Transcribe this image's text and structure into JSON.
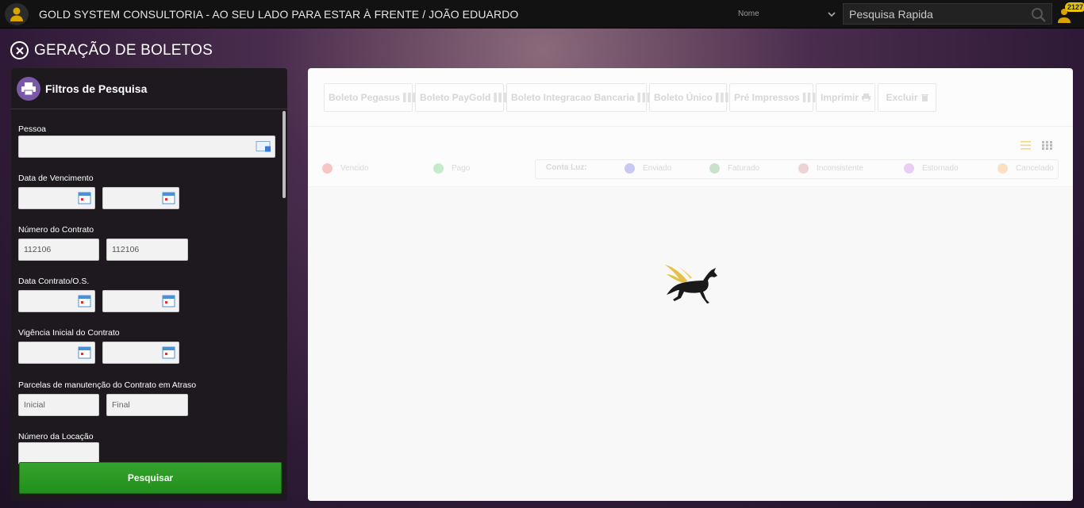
{
  "header": {
    "app_title": "GOLD SYSTEM CONSULTORIA - AO SEU LADO PARA ESTAR À FRENTE / JOÃO EDUARDO",
    "name_select": "Nome",
    "search_placeholder": "Pesquisa Rapida",
    "notification_count": "2127"
  },
  "page": {
    "title": "GERAÇÃO DE BOLETOS"
  },
  "filters": {
    "title": "Filtros de Pesquisa",
    "pessoa_label": "Pessoa",
    "vencimento_label": "Data de Vencimento",
    "contrato_label": "Número do Contrato",
    "contrato_from": "112106",
    "contrato_to": "112106",
    "data_contrato_label": "Data Contrato/O.S.",
    "vigencia_label": "Vigência Inicial do Contrato",
    "parcelas_label": "Parcelas de manutenção do Contrato em Atraso",
    "parcelas_inicial_placeholder": "Inicial",
    "parcelas_final_placeholder": "Final",
    "locacao_label": "Número da Locação",
    "search_button": "Pesquisar"
  },
  "toolbar": {
    "buttons": [
      "Boleto Pegasus",
      "Boleto PayGold",
      "Boleto Integracao Bancaria",
      "Boleto Único",
      "Pré Impressos",
      "Imprimir",
      "Excluir"
    ]
  },
  "legend": {
    "vencido": "Vencido",
    "pago": "Pago",
    "conta_luz": "Conta Luz:",
    "enviado": "Enviado",
    "faturado": "Faturado",
    "inconsistente": "Inconsistente",
    "estornado": "Estornado",
    "cancelado": "Cancelado",
    "colors": {
      "vencido": "#f6c6c6",
      "pago": "#c6ebc9",
      "enviado": "#c8c8f2",
      "faturado": "#c8e2cc",
      "inconsistente": "#ecd4d4",
      "estornado": "#e8cdf4",
      "cancelado": "#fbe0c4"
    }
  },
  "colors": {
    "accent_green": "#2a9a23",
    "filter_icon_purple": "#7a5aa8",
    "panel_dark": "#1d191f"
  }
}
